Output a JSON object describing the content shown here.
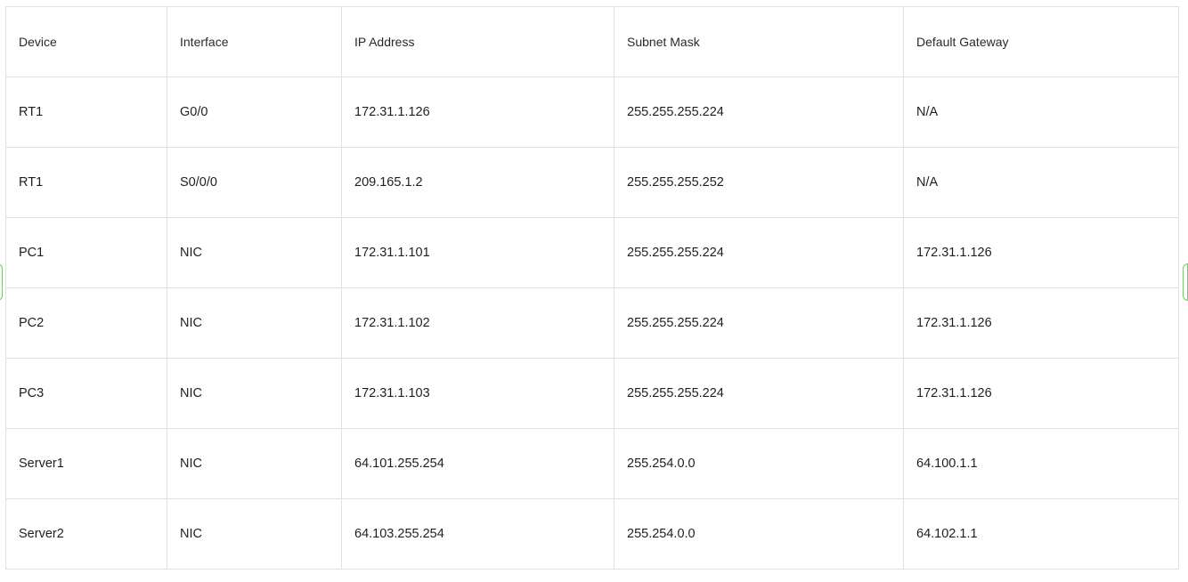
{
  "table": {
    "headers": [
      "Device",
      "Interface",
      "IP Address",
      "Subnet Mask",
      "Default Gateway"
    ],
    "rows": [
      [
        "RT1",
        "G0/0",
        "172.31.1.126",
        "255.255.255.224",
        "N/A"
      ],
      [
        "RT1",
        "S0/0/0",
        "209.165.1.2",
        "255.255.255.252",
        "N/A"
      ],
      [
        "PC1",
        "NIC",
        "172.31.1.101",
        "255.255.255.224",
        "172.31.1.126"
      ],
      [
        "PC2",
        "NIC",
        "172.31.1.102",
        "255.255.255.224",
        "172.31.1.126"
      ],
      [
        "PC3",
        "NIC",
        "172.31.1.103",
        "255.255.255.224",
        "172.31.1.126"
      ],
      [
        "Server1",
        "NIC",
        "64.101.255.254",
        "255.254.0.0",
        "64.100.1.1"
      ],
      [
        "Server2",
        "NIC",
        "64.103.255.254",
        "255.254.0.0",
        "64.102.1.1"
      ]
    ]
  },
  "colors": {
    "border": "#e0e0e0",
    "handle_accent": "#7cc47a",
    "text": "#1f1f1f"
  }
}
